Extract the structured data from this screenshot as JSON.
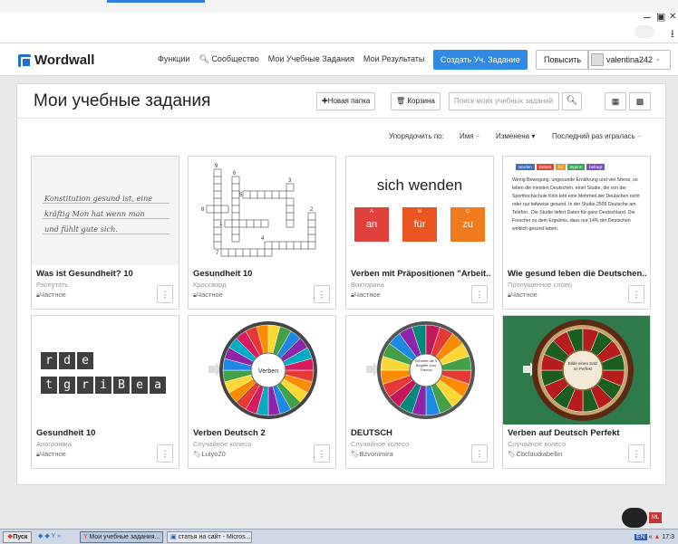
{
  "browser": {
    "win_controls": [
      "–",
      "🗗",
      "✕"
    ],
    "download_icon": "download-icon"
  },
  "site": {
    "logo": "Wordwall",
    "nav": [
      "Функции",
      "Сообщество",
      "Мои Учебные Задания",
      "Мои Результаты"
    ],
    "create_button": "Создать Уч. Задание",
    "upgrade_button": "Повысить",
    "username": "valentina242",
    "brand_color": "#2f8ae6"
  },
  "main": {
    "title": "Мои учебные задания",
    "new_folder": "Новая папка",
    "trash": "Корзина",
    "search_placeholder": "Поиск моих учебных заданий",
    "sort_label": "Упорядочить по:",
    "sort_name": "Имя",
    "sort_modified": "Изменена",
    "sort_last_played": "Последний раз игралась"
  },
  "cards": [
    {
      "title": "Was ist Gesundheit? 10",
      "type": "Распутать",
      "owner": "Частное",
      "owner_icon": "lock-icon"
    },
    {
      "title": "Gesundheit 10",
      "type": "Кроссворд",
      "owner": "Частное",
      "owner_icon": "lock-icon"
    },
    {
      "title": "Verben mit Präpositionen \"Arbeit...",
      "type": "Викторина",
      "owner": "Частное",
      "owner_icon": "lock-icon"
    },
    {
      "title": "Wie gesund leben die Deutschen...",
      "type": "Пропущенное слово",
      "owner": "Частное",
      "owner_icon": "lock-icon"
    },
    {
      "title": "Gesundheit 10",
      "type": "Анаграмма",
      "owner": "Частное",
      "owner_icon": "lock-icon"
    },
    {
      "title": "Verben Deutsch 2",
      "type": "Случайное колесо",
      "owner": "Lulyo20",
      "owner_icon": "bookmark-icon"
    },
    {
      "title": "DEUTSCH",
      "type": "Случайное колесо",
      "owner": "Bzvonimira",
      "owner_icon": "bookmark-icon"
    },
    {
      "title": "Verben auf Deutsch Perfekt",
      "type": "Случайное колесо",
      "owner": "Cbclaudiabellin",
      "owner_icon": "bookmark-icon"
    }
  ],
  "thumbs": {
    "hand_lines": [
      "Konstitution gesund ist, eine",
      "kräftig Mon hat wenn man",
      "und fühlt gute sich."
    ],
    "crossword_numbers": [
      "9",
      "6",
      "5",
      "3",
      "8",
      "2",
      "1",
      "4",
      "7"
    ],
    "quiz": {
      "word": "sich wenden",
      "answers": [
        {
          "label": "A",
          "text": "an",
          "color": "#e0413a"
        },
        {
          "label": "B",
          "text": "für",
          "color": "#ea5521"
        },
        {
          "label": "C",
          "text": "zu",
          "color": "#f07a1c"
        }
      ],
      "header_color": "#3a87d6"
    },
    "cloze_tags": [
      "werden",
      "kamen",
      "lol",
      "eigens",
      "befragt"
    ],
    "cloze_text": "Wenig Bewegung, ungesunde Ernährung und viel Stress, so leben die meisten Deutschen. einer Studie, die von der Sporthochschule Köln lebt eine Mehrheit der Deutschen nicht oder nur teilweise gesund. In der Studie 2509 Deutsche am Telefon . Die Studie liefert Daten für ganz Deutschland. Die Forscher zu dem Ergebnis, dass nur 14% der Deutschen wirklich gesund leben.",
    "anagram_row1": [
      "r",
      "d",
      "e"
    ],
    "anagram_row2": [
      "t",
      "g",
      "r",
      "i",
      "B",
      "e",
      "a"
    ],
    "wheel1_center": "Verben",
    "wheel2_center": "Schreibt die 5 Begriffe zum Thema!",
    "wheel3_center": "Bilde einen Satz im Perfekt"
  },
  "taskbar": {
    "start": "Пуск",
    "tasks": [
      "Мои учебные задания...",
      "статья на сайт - Micros..."
    ],
    "lang": "EN",
    "time": "17:3"
  }
}
